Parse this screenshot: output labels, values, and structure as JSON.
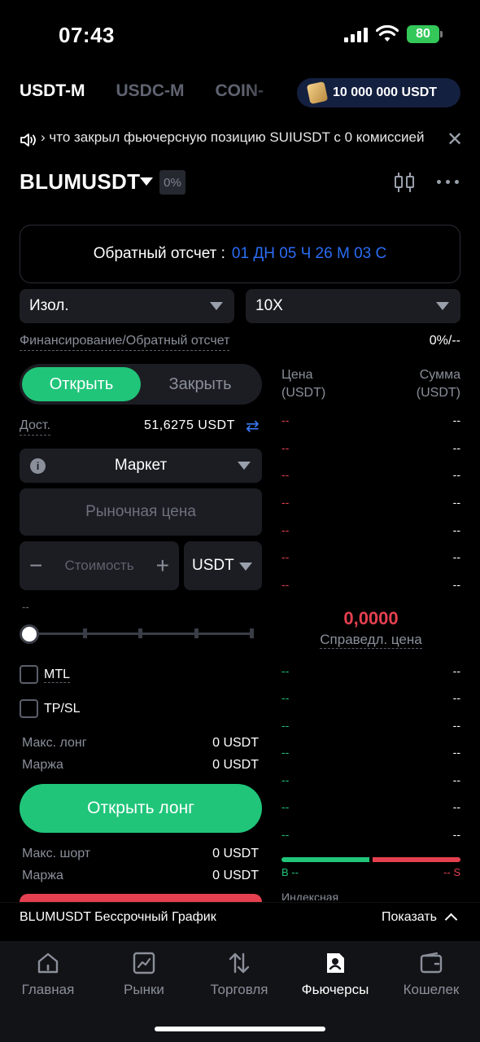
{
  "status_bar": {
    "time": "07:43",
    "battery": "80"
  },
  "header": {
    "tabs": [
      "USDT-M",
      "USDC-M",
      "COIN-"
    ],
    "bonus": "10 000 000 USDT"
  },
  "announcement": {
    "text": "› что закрыл фьючерсную позицию SUIUSDT с 0 комиссией"
  },
  "symbol": {
    "name": "BLUMUSDT",
    "change": "0%"
  },
  "countdown": {
    "label": "Обратный отсчет :",
    "value": "01 ДН 05 Ч 26 М 03 С"
  },
  "margin_mode": "Изол.",
  "leverage": "10X",
  "funding": {
    "label": "Финансирование/Обратный отсчет",
    "value": "0%/--"
  },
  "toggle": {
    "open": "Открыть",
    "close": "Закрыть"
  },
  "available": {
    "label": "Дост.",
    "value": "51,6275 USDT"
  },
  "order_type": "Маркет",
  "market_price_placeholder": "Рыночная цена",
  "value_input": {
    "minus": "−",
    "placeholder": "Стоимость",
    "plus": "+",
    "currency": "USDT"
  },
  "value_hint": "--",
  "checkboxes": {
    "mtl": "MTL",
    "tpsl": "TP/SL"
  },
  "long_info": {
    "max_label": "Макс. лонг",
    "max_value": "0 USDT",
    "margin_label": "Маржа",
    "margin_value": "0 USDT"
  },
  "open_long_button": "Открыть лонг",
  "short_info": {
    "max_label": "Макс. шорт",
    "max_value": "0 USDT",
    "margin_label": "Маржа",
    "margin_value": "0 USDT"
  },
  "orderbook": {
    "price_header": "Цена",
    "price_unit": "(USDT)",
    "amount_header": "Сумма",
    "amount_unit": "(USDT)",
    "asks": [
      "--",
      "--",
      "--",
      "--",
      "--",
      "--",
      "--"
    ],
    "bids": [
      "--",
      "--",
      "--",
      "--",
      "--",
      "--",
      "--"
    ],
    "placeholder": "--",
    "fair_price": "0,0000",
    "fair_label": "Справедл. цена",
    "buy_label": "B --",
    "sell_label": "-- S",
    "index_label": "Индексная"
  },
  "chart_bar": {
    "title": "BLUMUSDT Бессрочный График",
    "show": "Показать"
  },
  "nav": [
    {
      "label": "Главная",
      "icon": "home-icon"
    },
    {
      "label": "Рынки",
      "icon": "markets-icon"
    },
    {
      "label": "Торговля",
      "icon": "trade-icon"
    },
    {
      "label": "Фьючерсы",
      "icon": "futures-icon"
    },
    {
      "label": "Кошелек",
      "icon": "wallet-icon"
    }
  ],
  "colors": {
    "accent_green": "#20c57a",
    "accent_red": "#e5404f",
    "accent_blue": "#2a6df5"
  }
}
